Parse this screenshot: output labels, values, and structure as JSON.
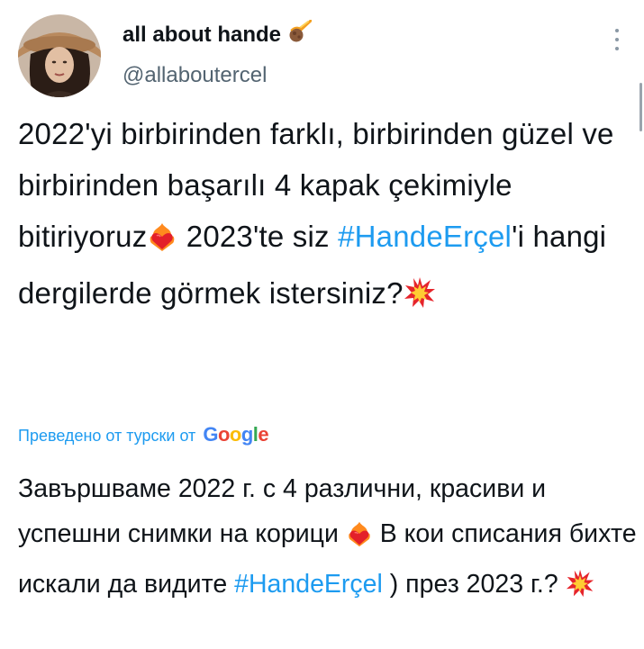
{
  "author": {
    "display_name": "all about hande",
    "handle": "@allaboutercel"
  },
  "tweet": {
    "text_part1": "2022'yi birbirinden farklı, birbirinden güzel ve birbirinden başarılı 4 kapak çekimiyle bitiriyoruz",
    "text_part2": " 2023'te siz ",
    "hashtag": "#HandeErçel",
    "text_part3": "'i hangi dergilerde görmek istersiniz?"
  },
  "translation": {
    "label": "Преведено от турски от",
    "provider": "Google",
    "provider_letters": [
      "G",
      "o",
      "o",
      "g",
      "l",
      "e"
    ],
    "provider_colors": [
      "#4285f4",
      "#ea4335",
      "#fbbc05",
      "#4285f4",
      "#34a853",
      "#ea4335"
    ],
    "text_part1": "Завършваме 2022 г. с 4 различни, красиви и успешни снимки на корици ",
    "text_part2": " В кои списания бихте искали да видите ",
    "hashtag": "#HandeErçel",
    "text_part3": " ) през 2023 г.? "
  },
  "icons": {
    "verified_like": "comet-emoji-icon",
    "fire_heart": "heart-on-fire-emoji-icon",
    "collision": "collision-emoji-icon",
    "more": "more-options-icon"
  },
  "colors": {
    "link": "#1d9bf0",
    "text": "#0f1419",
    "secondary": "#536471"
  }
}
